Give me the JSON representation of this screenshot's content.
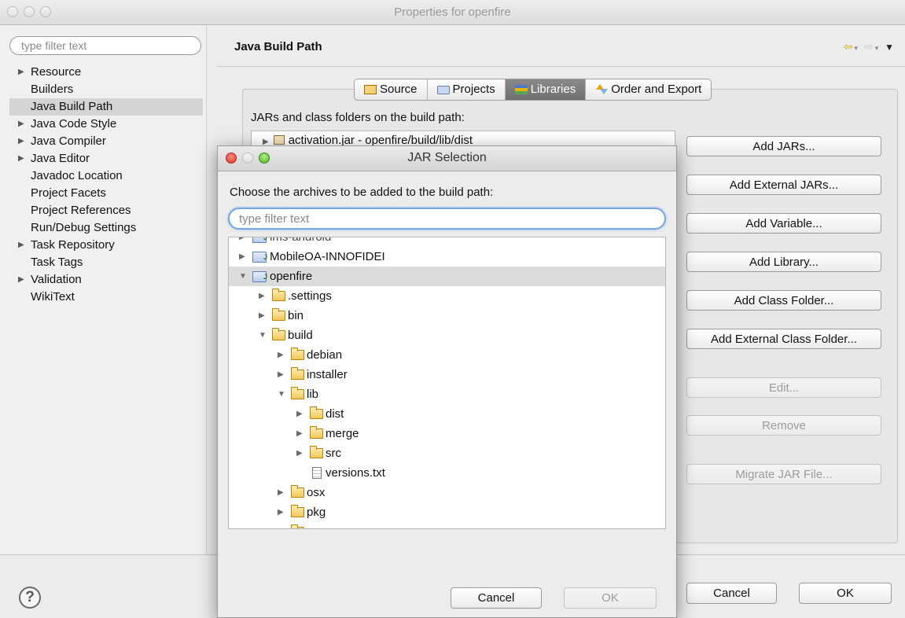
{
  "window": {
    "title": "Properties for openfire"
  },
  "left_panel": {
    "filter_placeholder": "type filter text",
    "items": [
      {
        "label": "Resource",
        "expandable": true
      },
      {
        "label": "Builders",
        "expandable": false
      },
      {
        "label": "Java Build Path",
        "expandable": false,
        "selected": true
      },
      {
        "label": "Java Code Style",
        "expandable": true
      },
      {
        "label": "Java Compiler",
        "expandable": true
      },
      {
        "label": "Java Editor",
        "expandable": true
      },
      {
        "label": "Javadoc Location",
        "expandable": false
      },
      {
        "label": "Project Facets",
        "expandable": false
      },
      {
        "label": "Project References",
        "expandable": false
      },
      {
        "label": "Run/Debug Settings",
        "expandable": false
      },
      {
        "label": "Task Repository",
        "expandable": true
      },
      {
        "label": "Task Tags",
        "expandable": false
      },
      {
        "label": "Validation",
        "expandable": true
      },
      {
        "label": "WikiText",
        "expandable": false
      }
    ]
  },
  "header": {
    "title": "Java Build Path"
  },
  "tabs": [
    {
      "label": "Source",
      "icon": "source-folder-icon"
    },
    {
      "label": "Projects",
      "icon": "projects-folder-icon"
    },
    {
      "label": "Libraries",
      "icon": "libraries-icon",
      "active": true
    },
    {
      "label": "Order and Export",
      "icon": "order-export-icon"
    }
  ],
  "libraries": {
    "label": "JARs and class folders on the build path:",
    "entries": [
      "activation.jar - openfire/build/lib/dist"
    ]
  },
  "side_buttons": {
    "add_jars": "Add JARs...",
    "add_external_jars": "Add External JARs...",
    "add_variable": "Add Variable...",
    "add_library": "Add Library...",
    "add_class_folder": "Add Class Folder...",
    "add_external_class_folder": "Add External Class Folder...",
    "edit": "Edit...",
    "remove": "Remove",
    "migrate_jar": "Migrate JAR File..."
  },
  "footer": {
    "cancel": "Cancel",
    "ok": "OK",
    "help": "?"
  },
  "dialog": {
    "title": "JAR Selection",
    "message": "Choose the archives to be added to the build path:",
    "filter_placeholder": "type filter text",
    "tree": {
      "partial_top": "ims-android",
      "rows": [
        "MobileOA-INNOFIDEI",
        "openfire",
        ".settings",
        "bin",
        "build",
        "debian",
        "installer",
        "lib",
        "dist",
        "merge",
        "src",
        "versions.txt",
        "osx",
        "pkg"
      ]
    },
    "cancel": "Cancel",
    "ok": "OK"
  },
  "colors": {
    "selection": "#d4d4d4",
    "active_tab": "#7a7a7a",
    "close_button": "#d9362b",
    "maximize_button": "#4fb128",
    "filter_focus": "#7aa7e0"
  }
}
